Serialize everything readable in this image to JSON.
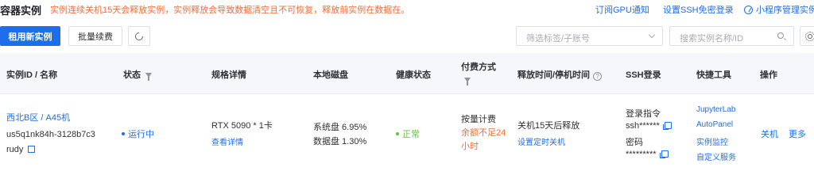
{
  "header": {
    "title": "容器实例",
    "notice": "实例连续关机15天会释放实例，实例释放会导致数据清空且不可恢复，释放前实例在数据在。",
    "links": [
      "订阅GPU通知",
      "设置SSH免密登录",
      "小程序管理实例"
    ]
  },
  "toolbar": {
    "rent_label": "租用新实例",
    "renew_label": "批量续费",
    "tag_filter_placeholder": "筛选标签/子账号",
    "search_placeholder": "搜索实例名称/ID"
  },
  "table": {
    "columns": [
      "实例ID / 名称",
      "状态",
      "规格详情",
      "本地磁盘",
      "健康状态",
      "付费方式",
      "释放时间/停机时间",
      "SSH登录",
      "快捷工具",
      "操作"
    ],
    "row": {
      "region": "西北B区 / A45机",
      "instance_id": "us5q1nk84h-3128b7c3",
      "name": "rudy",
      "status": "运行中",
      "spec": "RTX 5090 * 1卡",
      "spec_link": "查看详情",
      "disk_system": "系统盘 6.95%",
      "disk_data": "数据盘 1.30%",
      "health": "正常",
      "billing": "按量计费",
      "billing_warning": "余额不足24小时",
      "release_time": "关机15天后释放",
      "release_link": "设置定时关机",
      "ssh_cmd_label": "登录指令",
      "ssh_cmd": "ssh******",
      "ssh_pwd_label": "密码",
      "ssh_pwd": "*********",
      "tools": [
        "JupyterLab",
        "AutoPanel",
        "实例监控",
        "自定义服务"
      ],
      "actions": [
        "关机",
        "更多"
      ]
    }
  },
  "colors": {
    "primary": "#1d6ee8",
    "warning": "#f56c36",
    "running": "#1d6ee8",
    "healthy": "#67c23a"
  }
}
